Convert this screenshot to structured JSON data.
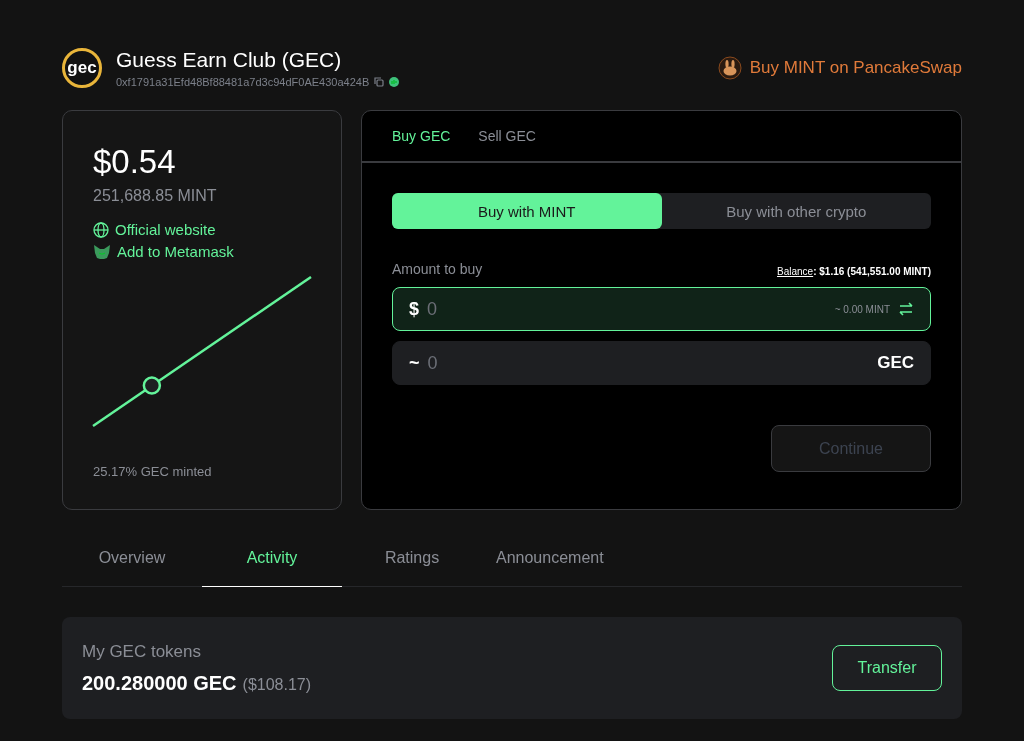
{
  "token": {
    "logo": "gec",
    "name": "Guess Earn Club (GEC)",
    "address": "0xf1791a31Efd48Bf88481a7d3c94dF0AE430a424B"
  },
  "swap_link": "Buy MINT on PancakeSwap",
  "price_card": {
    "price": "$0.54",
    "price_mint": "251,688.85 MINT",
    "links": [
      {
        "kind": "website",
        "label": "Official website"
      },
      {
        "kind": "metamask",
        "label": "Add to Metamask"
      }
    ],
    "curve": {
      "level": 0.27
    },
    "minted": "25.17% GEC minted"
  },
  "trade": {
    "tabs": [
      {
        "label": "Buy GEC",
        "selected": true
      },
      {
        "label": "Sell GEC",
        "selected": false
      }
    ],
    "modes": [
      {
        "label": "Buy with MINT",
        "selected": true
      },
      {
        "label": "Buy with other crypto",
        "selected": false
      }
    ],
    "amount_label": "Amount to buy",
    "balance_link": "Balance",
    "balance_value": ": $1.16 (541,551.00 MINT)",
    "pay_field": {
      "prefix": "$",
      "placeholder": "0",
      "conversion": "~ 0.00 MINT",
      "focused": true
    },
    "receive_field": {
      "prefix": "~",
      "placeholder": "0",
      "unit": "GEC"
    },
    "continue": {
      "label": "Continue",
      "disabled": true
    }
  },
  "section_tabs": [
    {
      "label": "Overview",
      "selected": false
    },
    {
      "label": "Activity",
      "selected": true
    },
    {
      "label": "Ratings",
      "selected": false
    },
    {
      "label": "Announcement",
      "selected": false
    }
  ],
  "holdings": {
    "title": "My GEC tokens",
    "amount": "200.280000 GEC",
    "value": "($108.17)",
    "button": "Transfer"
  }
}
